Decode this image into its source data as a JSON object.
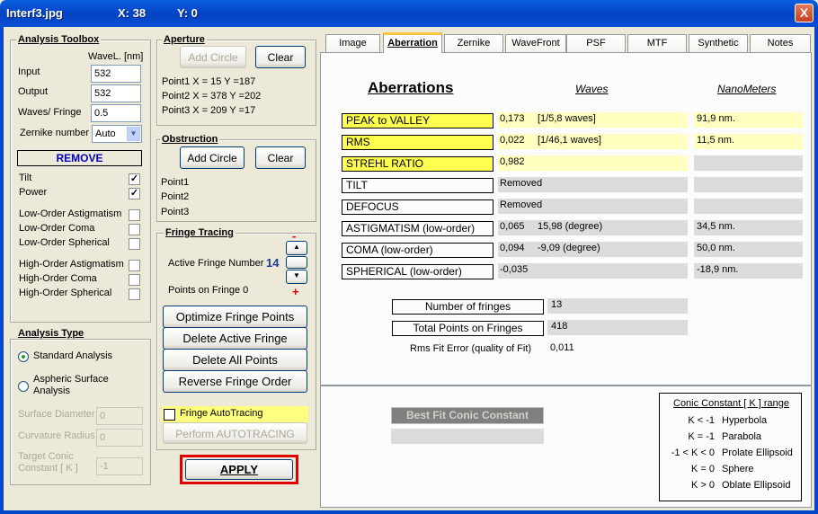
{
  "window": {
    "title": "Interf3.jpg",
    "x_readout": "X: 38",
    "y_readout": "Y: 0",
    "close": "X"
  },
  "toolbox": {
    "title": "Analysis Toolbox",
    "wavel_header": "WaveL. [nm]",
    "input_label": "Input",
    "input_value": "532",
    "output_label": "Output",
    "output_value": "532",
    "waves_label": "Waves/ Fringe",
    "waves_value": "0.5",
    "zernike_label": "Zernike number",
    "zernike_value": "Auto",
    "remove": "REMOVE",
    "checks": [
      {
        "label": "Tilt",
        "checked": true
      },
      {
        "label": "Power",
        "checked": true
      },
      {
        "label": "Low-Order Astigmatism",
        "checked": false
      },
      {
        "label": "Low-Order Coma",
        "checked": false
      },
      {
        "label": "Low-Order Spherical",
        "checked": false
      },
      {
        "label": "High-Order Astigmatism",
        "checked": false
      },
      {
        "label": "High-Order Coma",
        "checked": false
      },
      {
        "label": "High-Order Spherical",
        "checked": false
      }
    ]
  },
  "aperture": {
    "title": "Aperture",
    "add": "Add Circle",
    "clear": "Clear",
    "p1": "Point1 X =   15  Y =187",
    "p2": "Point2 X =  378  Y =202",
    "p3": "Point3 X =  209  Y =17"
  },
  "obstruction": {
    "title": "Obstruction",
    "add": "Add Circle",
    "clear": "Clear",
    "p1": "Point1",
    "p2": "Point2",
    "p3": "Point3"
  },
  "fringe": {
    "title": "Fringe Tracing",
    "active_label": "Active Fringe Number",
    "active_value": "14",
    "points_label": "Points on  Fringe 0",
    "minus": "-",
    "plus": "+",
    "optimize": "Optimize Fringe Points",
    "delete_active": "Delete Active Fringe",
    "delete_all": "Delete  All  Points",
    "reverse": "Reverse  Fringe Order",
    "autotracing": "Fringe AutoTracing",
    "perform": "Perform  AUTOTRACING"
  },
  "apply": "APPLY",
  "analysis_type": {
    "title": "Analysis Type",
    "standard": "Standard Analysis",
    "aspheric": "Aspheric  Surface Analysis",
    "surface_diameter": "Surface Diameter",
    "surface_diameter_value": "0",
    "curvature_radius": "Curvature Radius",
    "curvature_radius_value": "0",
    "target_conic": "Target Conic Constant [ K ]",
    "target_conic_value": "-1"
  },
  "tabs": [
    {
      "label": "Image"
    },
    {
      "label": "Aberration",
      "active": true
    },
    {
      "label": "Zernike"
    },
    {
      "label": "WaveFront"
    },
    {
      "label": "PSF"
    },
    {
      "label": "MTF"
    },
    {
      "label": "Synthetic"
    },
    {
      "label": "Notes"
    }
  ],
  "aberr": {
    "title": "Aberrations ",
    "col_waves": "Waves",
    "col_nm": "NanoMeters",
    "rows": [
      {
        "label": "PEAK to VALLEY",
        "value": "0,173",
        "detail": "[1/5,8 waves]",
        "nm": "91,9  nm."
      },
      {
        "label": "RMS",
        "value": "0,022",
        "detail": "[1/46,1 waves]",
        "nm": "11,5  nm."
      },
      {
        "label": "STREHL   RATIO",
        "value": "0,982",
        "detail": "",
        "nm": ""
      },
      {
        "label": "TILT",
        "value": "Removed",
        "detail": "",
        "nm": ""
      },
      {
        "label": "DEFOCUS",
        "value": "Removed",
        "detail": "",
        "nm": ""
      },
      {
        "label": "ASTIGMATISM  (low-order)",
        "value": "0,065",
        "detail": "15,98  (degree)",
        "nm": "34,5  nm."
      },
      {
        "label": "COMA              (low-order)",
        "value": "0,094",
        "detail": "-9,09  (degree)",
        "nm": "50,0  nm."
      },
      {
        "label": "SPHERICAL     (low-order)",
        "value": "-0,035",
        "detail": "",
        "nm": "-18,9  nm."
      }
    ],
    "num_fringes_label": "Number of fringes",
    "num_fringes": "13",
    "total_points_label": "Total  Points on Fringes",
    "total_points": "418",
    "rms_fit_label": "Rms Fit Error (quality of Fit)",
    "rms_fit": "0,011"
  },
  "conic": {
    "best_fit": "Best Fit Conic Constant",
    "title": "Conic Constant [ K ]  range",
    "rows": [
      {
        "k": "K < -1",
        "name": "Hyperbola"
      },
      {
        "k": "K = -1",
        "name": "Parabola"
      },
      {
        "k": "-1 < K < 0",
        "name": "Prolate Ellipsoid"
      },
      {
        "k": "K =  0",
        "name": "Sphere"
      },
      {
        "k": "K > 0",
        "name": "Oblate Ellipsoid"
      }
    ]
  },
  "colors": {
    "title_bar": "#0447c8",
    "highlight": "#ffff50",
    "apply_border": "#e00000",
    "tab_active": "#ffc83c"
  }
}
